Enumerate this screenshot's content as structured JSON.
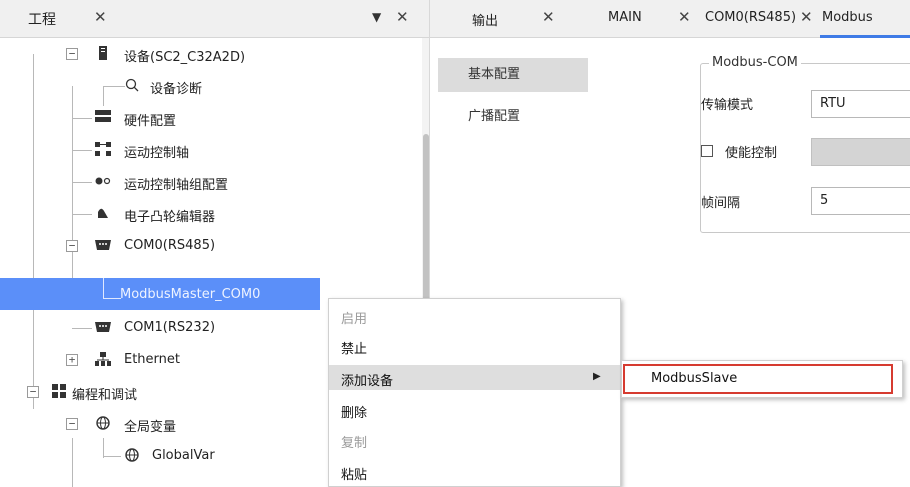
{
  "left_panel": {
    "tab": {
      "label": "工程",
      "close": "✕"
    },
    "menu_icon": "▼",
    "close_icon": "✕",
    "tree": [
      {
        "label": "设备(SC2_C32A2D)",
        "icon": "device-icon",
        "expander": "−"
      },
      {
        "label": "设备诊断",
        "icon": "search-icon"
      },
      {
        "label": "硬件配置",
        "icon": "hardware-icon"
      },
      {
        "label": "运动控制轴",
        "icon": "axis-icon"
      },
      {
        "label": "运动控制轴组配置",
        "icon": "axis-group-icon"
      },
      {
        "label": "电子凸轮编辑器",
        "icon": "cam-icon"
      },
      {
        "label": "COM0(RS485)",
        "icon": "serial-port-icon",
        "expander": "−"
      },
      {
        "label": "ModbusMaster_COM0",
        "icon": "",
        "selected": true
      },
      {
        "label": "COM1(RS232)",
        "icon": "serial-port-icon"
      },
      {
        "label": "Ethernet",
        "icon": "network-icon",
        "expander": "+"
      },
      {
        "label": "编程和调试",
        "icon": "programming-icon",
        "expander": "−"
      },
      {
        "label": "全局变量",
        "icon": "globe-icon",
        "expander": "−"
      },
      {
        "label": "GlobalVar",
        "icon": "globe-icon"
      }
    ]
  },
  "editor_tabs": [
    {
      "label": "输出",
      "close": "✕"
    },
    {
      "label": "MAIN",
      "close": "✕"
    },
    {
      "label": "COM0(RS485)",
      "close": "✕"
    },
    {
      "label": "Modbus"
    }
  ],
  "config_nav": [
    {
      "label": "基本配置",
      "active": true
    },
    {
      "label": "广播配置"
    }
  ],
  "group_box": {
    "title": "Modbus-COM",
    "transfer_mode_label": "传输模式",
    "transfer_mode_value": "RTU",
    "enable_control_label": "使能控制",
    "frame_interval_label": "帧间隔",
    "frame_interval_value": "5"
  },
  "context_menu": {
    "items": [
      {
        "label": "启用",
        "disabled": true
      },
      {
        "label": "禁止"
      },
      {
        "label": "添加设备",
        "has_submenu": true,
        "submenu_arrow": "▶"
      },
      {
        "label": "删除"
      },
      {
        "label": "复制",
        "disabled": true
      },
      {
        "label": "粘贴"
      }
    ],
    "submenu": {
      "label": "ModbusSlave"
    }
  },
  "colors": {
    "selection": "#5b8ff9",
    "highlight_border": "#d63b30",
    "active_tab_underline": "#3f7be6"
  }
}
